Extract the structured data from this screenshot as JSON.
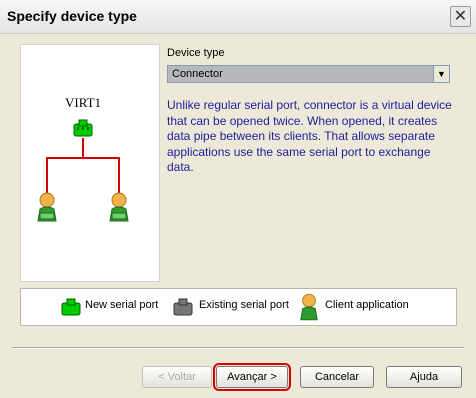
{
  "window": {
    "title": "Specify device type"
  },
  "diagram": {
    "device_label": "VIRT1"
  },
  "device_type": {
    "label": "Device type",
    "selected": "Connector"
  },
  "description": "Unlike regular serial port, connector is a virtual device that can be opened twice. When opened, it creates data pipe between its clients. That allows separate applications use the same serial port to exchange data.",
  "legend": {
    "new_port": "New serial port",
    "existing_port": "Existing serial port",
    "client_app": "Client application"
  },
  "buttons": {
    "back": "< Voltar",
    "next": "Avançar >",
    "cancel": "Cancelar",
    "help": "Ajuda"
  },
  "colors": {
    "new_port": "#00cc00",
    "existing_port": "#777777",
    "client": "#2e9b2e",
    "line": "#d40000",
    "description_text": "#1d1d9e"
  }
}
